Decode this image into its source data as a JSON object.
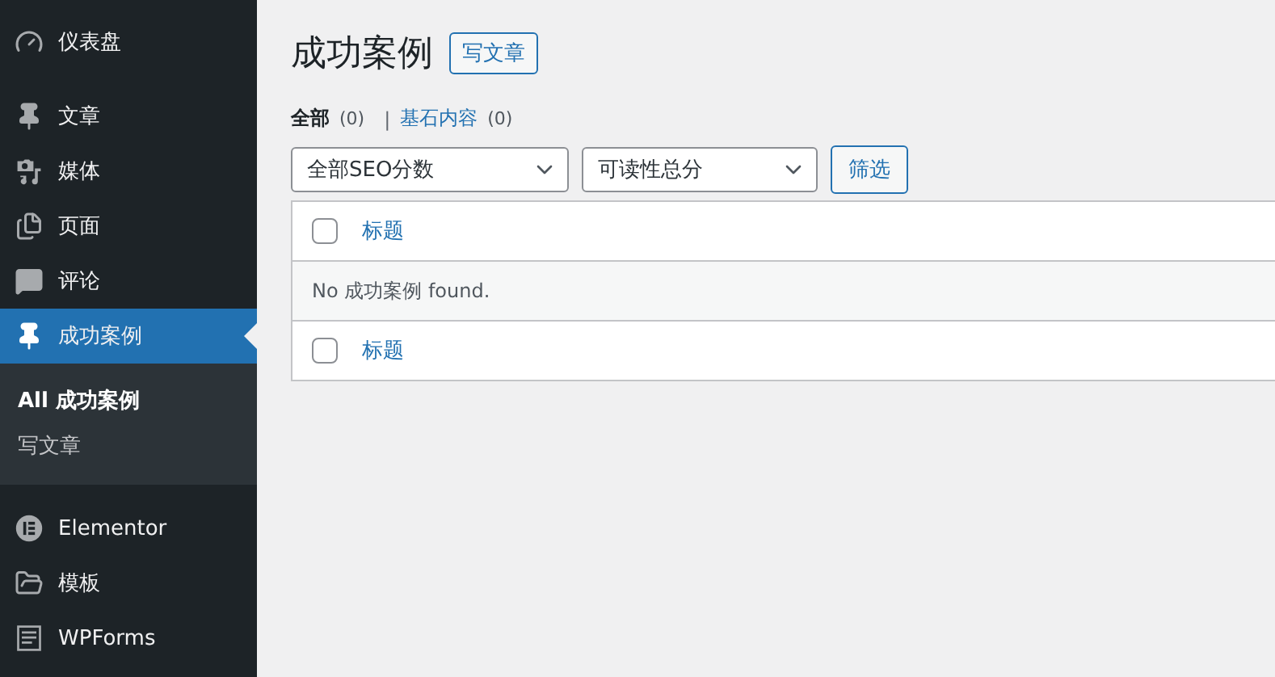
{
  "sidebar": {
    "items": [
      {
        "kind": "gauge",
        "label": "仪表盘",
        "selected": false
      },
      {
        "kind": "pin",
        "label": "文章",
        "selected": false
      },
      {
        "kind": "media",
        "label": "媒体",
        "selected": false
      },
      {
        "kind": "pages",
        "label": "页面",
        "selected": false
      },
      {
        "kind": "comment",
        "label": "评论",
        "selected": false
      },
      {
        "kind": "pin",
        "label": "成功案例",
        "selected": true,
        "submenu": [
          {
            "label": "All 成功案例",
            "selected": true
          },
          {
            "label": "写文章",
            "selected": false
          }
        ]
      },
      {
        "kind": "elementor",
        "label": "Elementor",
        "selected": false
      },
      {
        "kind": "folder",
        "label": "模板",
        "selected": false
      },
      {
        "kind": "form",
        "label": "WPForms",
        "selected": false
      }
    ]
  },
  "page": {
    "title": "成功案例",
    "add_button": "写文章"
  },
  "views": [
    {
      "label": "全部",
      "count": "(0)",
      "selected": true
    },
    {
      "separator": "|",
      "label": "基石内容",
      "count": "(0)",
      "selected": false
    }
  ],
  "filters": [
    {
      "value": "全部SEO分数"
    },
    {
      "value": "可读性总分"
    }
  ],
  "filter_button": "筛选",
  "table": {
    "header": {
      "column": "标题",
      "checked": false
    },
    "empty_message": "No 成功案例 found.",
    "footer": {
      "column": "标题",
      "checked": false
    }
  }
}
